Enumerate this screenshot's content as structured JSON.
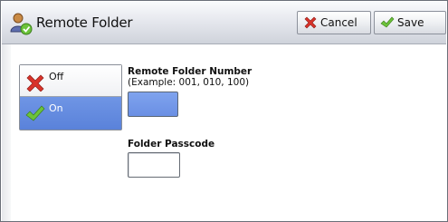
{
  "window": {
    "title": "Remote Folder",
    "title_icon": "user-folder-icon"
  },
  "toolbar": {
    "cancel_label": "Cancel",
    "cancel_icon": "x-icon",
    "save_label": "Save",
    "save_icon": "check-icon"
  },
  "options": {
    "items": [
      {
        "label": "Off",
        "icon": "x-icon",
        "selected": false
      },
      {
        "label": "On",
        "icon": "check-icon",
        "selected": true
      }
    ]
  },
  "fields": {
    "remote_folder_number_label": "Remote Folder Number",
    "remote_folder_number_hint": "(Example: 001, 010, 100)",
    "remote_folder_number_value": "",
    "folder_passcode_label": "Folder Passcode",
    "folder_passcode_value": ""
  },
  "colors": {
    "selected_blue": "#5a82da",
    "cancel_red": "#d9332a",
    "check_green": "#6cc33a"
  }
}
